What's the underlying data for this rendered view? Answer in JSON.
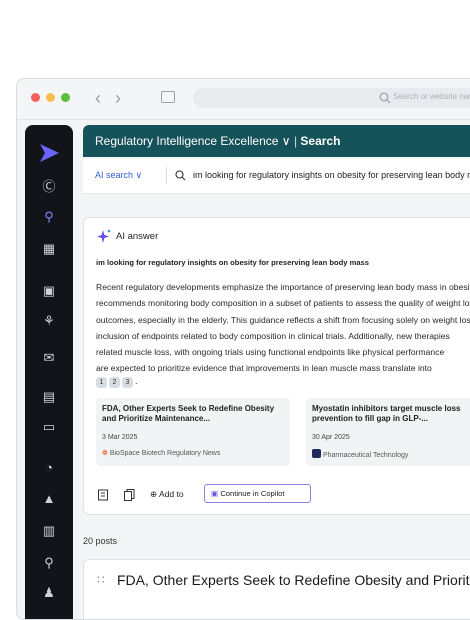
{
  "browser": {
    "url_placeholder": "Search or website name"
  },
  "header": {
    "workspace_title": "Regulatory Intelligence Excellence",
    "section": "Search"
  },
  "search": {
    "mode": "AI search",
    "query": "im looking for regulatory insights on obesity for preserving lean body mass"
  },
  "answer": {
    "label": "AI answer",
    "question": "im looking for regulatory insights on obesity for preserving lean body mass",
    "lines": [
      "Recent regulatory developments emphasize the importance of preserving lean body mass in obesity",
      "recommends monitoring body composition in a subset of patients to assess the quality of weight loss",
      "outcomes, especially in the elderly. This guidance reflects a shift from focusing solely on weight loss",
      "inclusion of endpoints related to body composition in clinical trials. Additionally, new therapies",
      "related muscle loss, with ongoing trials using functional endpoints like physical performance",
      "are expected to prioritize evidence that improvements in lean muscle mass translate into"
    ],
    "citations": [
      "1",
      "2",
      "3"
    ]
  },
  "sources": [
    {
      "title": "FDA, Other Experts Seek to Redefine Obesity and Prioritize Maintenance...",
      "date": "3 Mar 2025",
      "publisher": "BioSpace Biotech Regulatory News"
    },
    {
      "title": "Myostatin inhibitors target muscle loss prevention to fill gap in GLP-...",
      "date": "30 Apr 2025",
      "publisher": "Pharmaceutical Technology"
    }
  ],
  "actions": {
    "add_to": "Add to",
    "copilot": "Continue in Copilot"
  },
  "results": {
    "count": "20 posts",
    "first_title": "FDA, Other Experts Seek to Redefine Obesity and Prioritize Maintenance"
  },
  "colors": {
    "teal": "#16525a",
    "accent": "#2f5fd0",
    "purple": "#7b61ff",
    "sidebar": "#12141a"
  }
}
